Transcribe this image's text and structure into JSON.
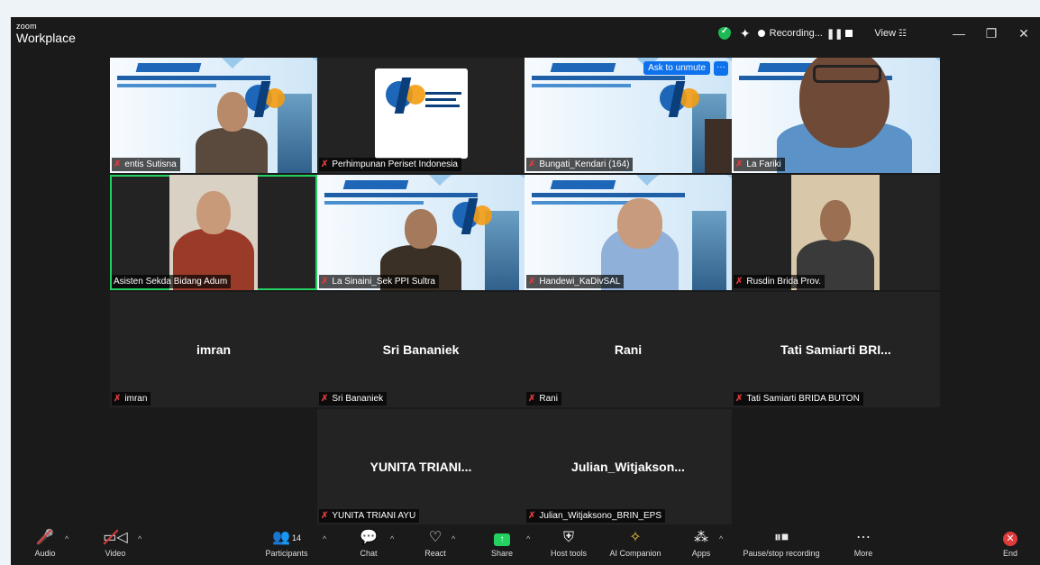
{
  "app": {
    "brand_small": "zoom",
    "brand_big": "Workplace",
    "recording_label": "Recording...",
    "pause_glyph": "❚❚",
    "view_label": "View",
    "grid_glyph": "☷",
    "min_glyph": "—",
    "restore_glyph": "❐",
    "close_glyph": "✕",
    "sparkle_glyph": "✦"
  },
  "tiles": {
    "t1": {
      "name": "entis Sutisna"
    },
    "t2": {
      "name": "Perhimpunan Periset Indonesia"
    },
    "t3": {
      "name": "Bungati_Kendari (164)",
      "ask_unmute": "Ask to unmute",
      "more": "···"
    },
    "t4": {
      "name": "La Fariki"
    },
    "t5": {
      "name": "Asisten Sekda Bidang Adum"
    },
    "t6": {
      "name": "La Sinaini_Sek PPI Sultra"
    },
    "t7": {
      "name": "Handewi_KaDivSAL"
    },
    "t8": {
      "name": "Rusdin Brida Prov."
    },
    "t9": {
      "display": "imran",
      "name": "imran"
    },
    "t10": {
      "display": "Sri Bananiek",
      "name": "Sri Bananiek"
    },
    "t11": {
      "display": "Rani",
      "name": "Rani"
    },
    "t12": {
      "display": "Tati Samiarti BRI...",
      "name": "Tati Samiarti BRIDA BUTON"
    },
    "t13": {
      "display": "YUNITA TRIANI...",
      "name": "YUNITA TRIANI AYU"
    },
    "t14": {
      "display": "Julian_Witjakson...",
      "name": "Julian_Witjaksono_BRIN_EPS"
    }
  },
  "mic_off_glyph": "✗",
  "toolbar": {
    "caret": "^",
    "audio": {
      "label": "Audio",
      "icon": "🎤"
    },
    "video": {
      "label": "Video",
      "icon": "▭◁"
    },
    "participants": {
      "label": "Participants",
      "icon": "👥",
      "count": "14"
    },
    "chat": {
      "label": "Chat",
      "icon": "💬"
    },
    "react": {
      "label": "React",
      "icon": "♡"
    },
    "share": {
      "label": "Share",
      "icon": "↑"
    },
    "hosttools": {
      "label": "Host tools",
      "icon": "⛨"
    },
    "aicompanion": {
      "label": "AI Companion",
      "icon": "✧"
    },
    "apps": {
      "label": "Apps",
      "icon": "⁂"
    },
    "recording": {
      "label": "Pause/stop recording",
      "icon": "⏸⏹"
    },
    "more": {
      "label": "More",
      "icon": "⋯"
    },
    "end": {
      "label": "End",
      "icon": "✕"
    }
  }
}
